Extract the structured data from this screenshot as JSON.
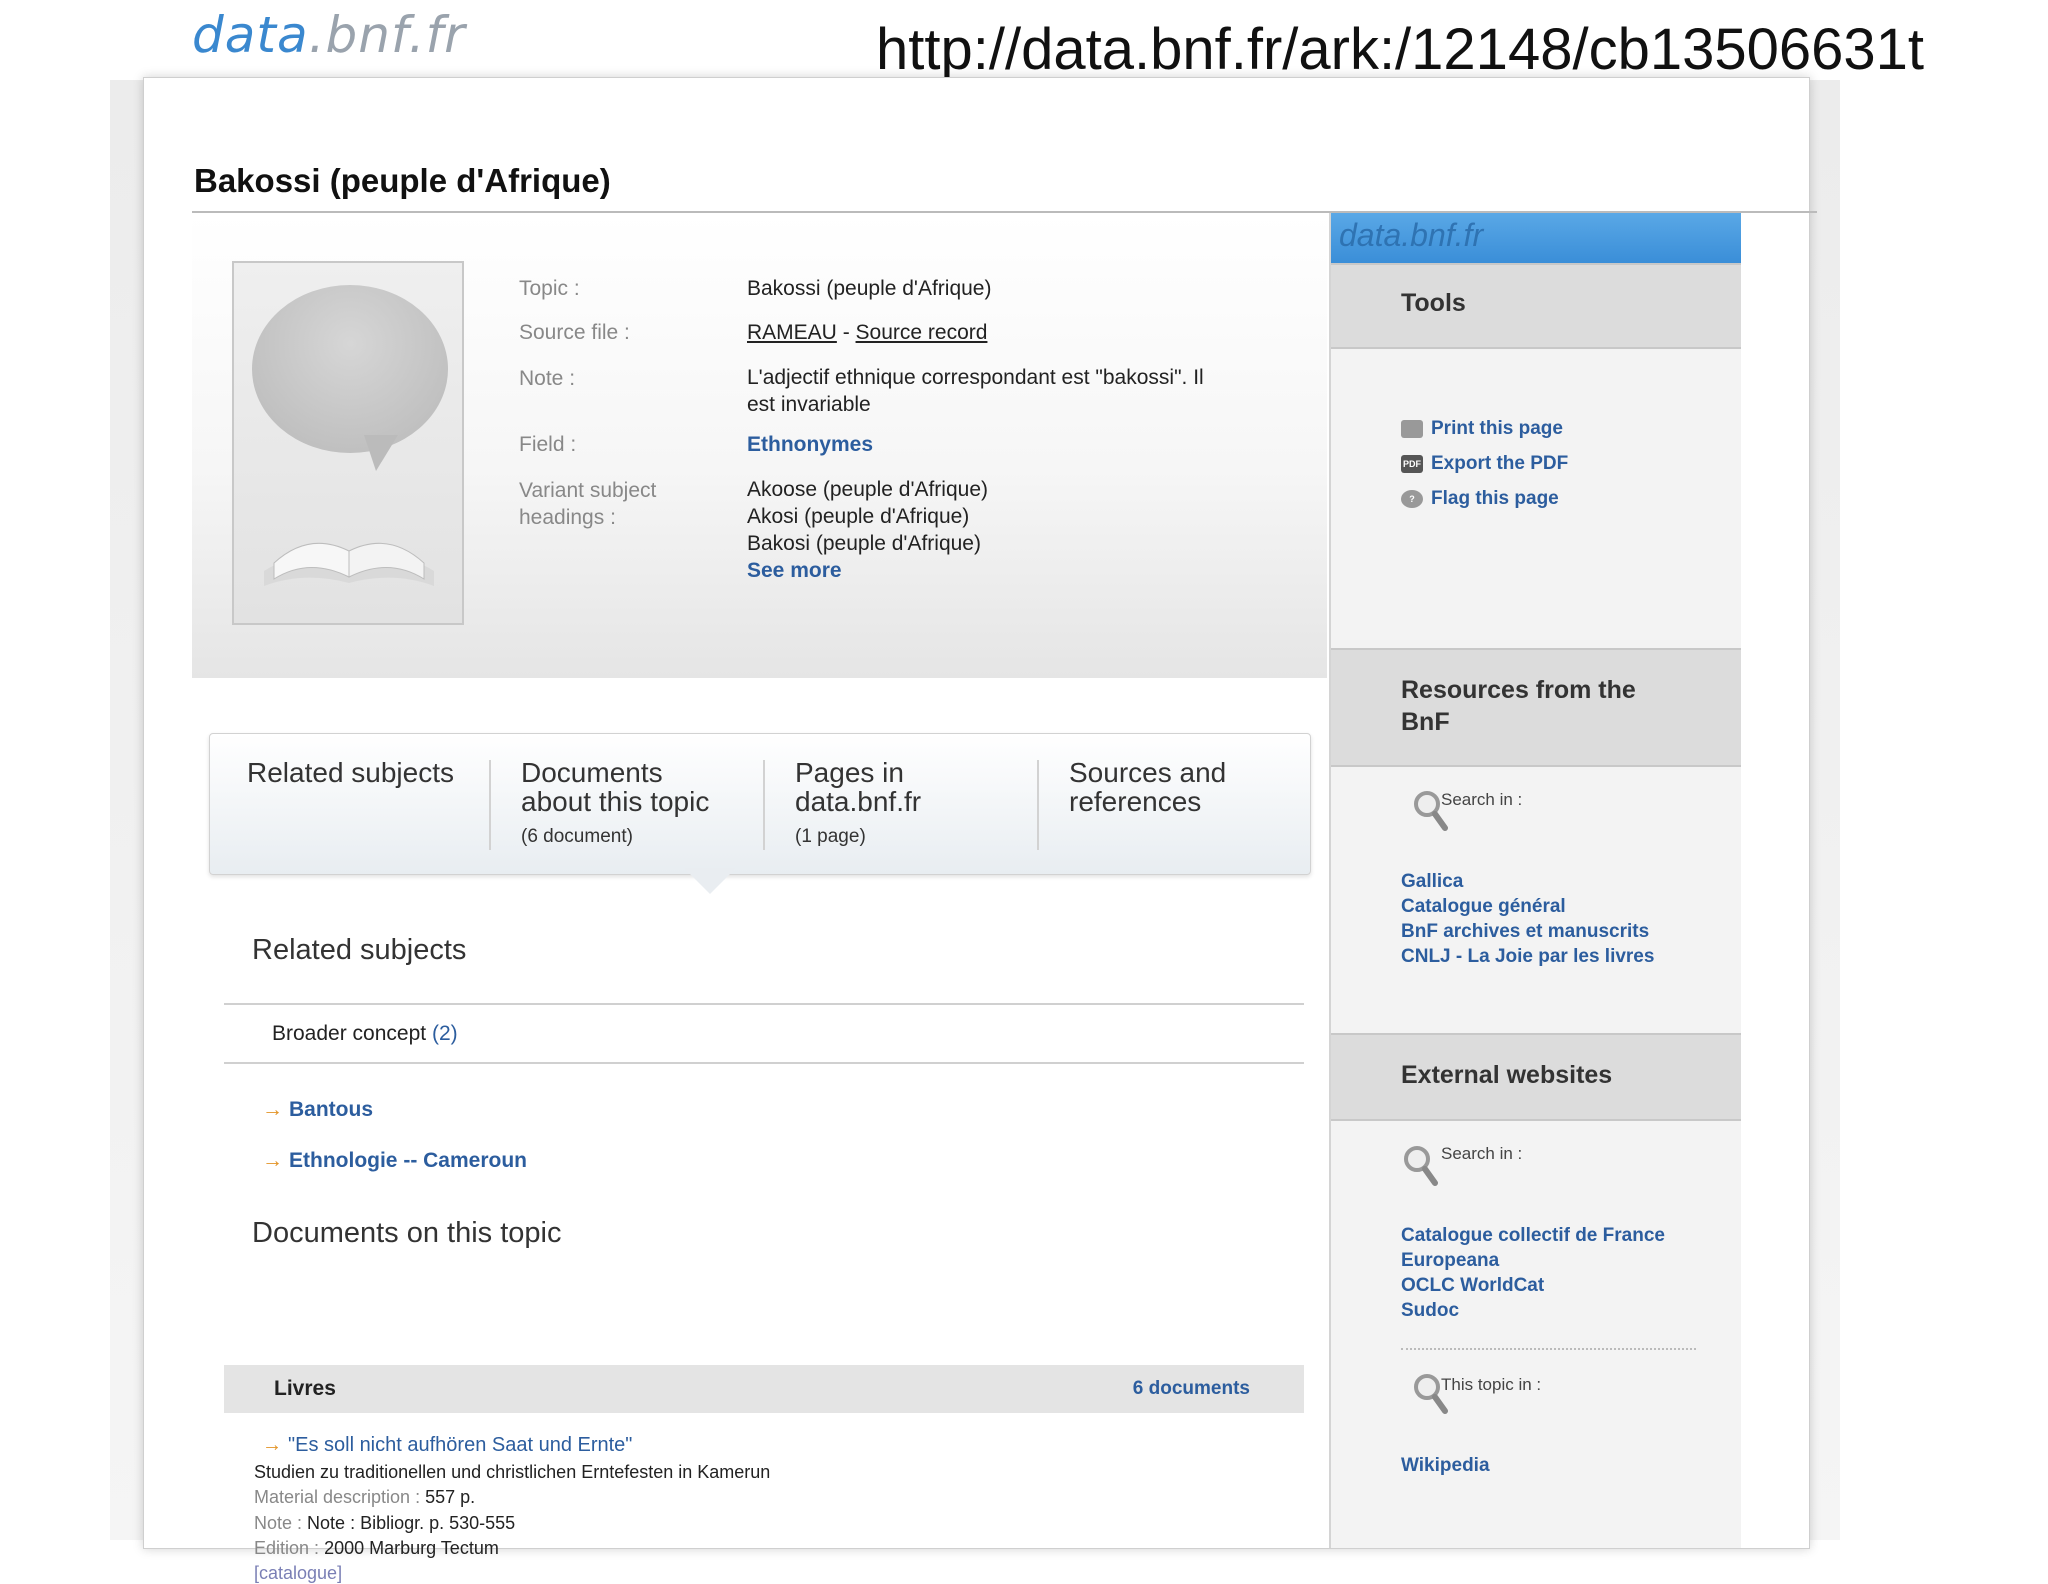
{
  "slide": {
    "logo": {
      "part1": "data",
      "part2": ".",
      "part3": "bnf.fr"
    },
    "url": "http://data.bnf.fr/ark:/12148/cb13506631t"
  },
  "page": {
    "title": "Bakossi (peuple d'Afrique)",
    "info": {
      "topic_label": "Topic :",
      "topic_value": "Bakossi (peuple d'Afrique)",
      "source_label": "Source file :",
      "source_link1": "RAMEAU",
      "source_sep": " - ",
      "source_link2": "Source record",
      "note_label": "Note :",
      "note_line1": "L'adjectif ethnique correspondant est \"bakossi\". Il",
      "note_line2": "est invariable",
      "field_label": "Field :",
      "field_value": "Ethnonymes",
      "variant_label_1": "Variant subject",
      "variant_label_2": "headings :",
      "variants": [
        "Akoose (peuple d'Afrique)",
        "Akosi (peuple d'Afrique)",
        "Bakosi (peuple d'Afrique)"
      ],
      "see_more": "See more"
    },
    "tabs": [
      {
        "line1": "Related subjects",
        "line2": "",
        "count": ""
      },
      {
        "line1": "Documents",
        "line2": "about this topic",
        "count": "(6 document)"
      },
      {
        "line1": "Pages in",
        "line2": "data.bnf.fr",
        "count": "(1 page)"
      },
      {
        "line1": "Sources and",
        "line2": "references",
        "count": ""
      }
    ],
    "related": {
      "heading": "Related subjects",
      "broader_label": "Broader concept",
      "broader_count": "(2)",
      "links": [
        "Bantous",
        "Ethnologie -- Cameroun"
      ]
    },
    "documents": {
      "heading": "Documents on this topic",
      "bar_label": "Livres",
      "bar_count": "6 documents",
      "item": {
        "title": "\"Es soll nicht aufhören Saat und Ernte\"",
        "subtitle": "Studien zu traditionellen und christlichen Erntefesten in Kamerun",
        "material_label": "Material description :",
        "material_value": "557 p.",
        "note_label": "Note :",
        "note_value": "Note : Bibliogr. p. 530-555",
        "edition_label": "Edition :",
        "edition_value": "2000 Marburg Tectum",
        "catalogue": "[catalogue]"
      }
    }
  },
  "sidebar": {
    "brand": "data.bnf.fr",
    "tools_heading": "Tools",
    "tools": [
      "Print this page",
      "Export the PDF",
      "Flag this page"
    ],
    "pdf_icon_text": "PDF",
    "resources_heading_1": "Resources from the",
    "resources_heading_2": "BnF",
    "search_in": "Search in :",
    "resources_links": [
      "Gallica",
      "Catalogue général",
      "BnF archives et manuscrits",
      "CNLJ - La Joie par les livres"
    ],
    "external_heading": "External websites",
    "external_links": [
      "Catalogue collectif de France",
      "Europeana",
      "OCLC WorldCat",
      "Sudoc"
    ],
    "topic_in": "This topic in :",
    "wiki_link": "Wikipedia"
  },
  "colors": {
    "link": "#2c5d9e",
    "arrow": "#e39427",
    "brand_blue": "#3a8ed8"
  }
}
